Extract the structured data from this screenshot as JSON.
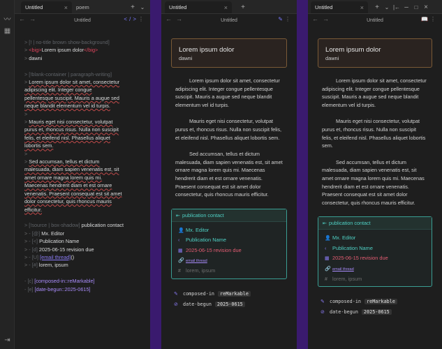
{
  "ribbon": {
    "icons": [
      "pulse-icon",
      "calendar-icon",
      "sidebar-toggle-icon"
    ]
  },
  "panes": {
    "left": {
      "tabs": [
        {
          "label": "Untitled",
          "active": true
        },
        {
          "label": "poem",
          "active": false
        }
      ],
      "title": "Untitled"
    },
    "mid": {
      "tabs": [
        {
          "label": "Untitled",
          "active": true
        }
      ],
      "title": "Untitled"
    },
    "right": {
      "tabs": [
        {
          "label": "Untitled",
          "active": true
        }
      ],
      "title": "Untitled"
    }
  },
  "editor": {
    "l1": "> [! | no-title brown show-background]",
    "l2_open": "<big>",
    "l2_text": "Lorem ipsum dolor",
    "l2_close": "</big>",
    "l3": "dawni",
    "l4": "> [!blank-container | paragraph-writing]",
    "p1": [
      "Lorem ipsum dolor sit amet, consectetur",
      "adipiscing elit. Integer congue",
      "pellentesque suscipit. Mauris a augue sed",
      "neque blandit elementum vel id turpis."
    ],
    "p2": [
      "Mauris eget nisi consectetur, volutpat",
      "purus et, rhoncus risus. Nulla non suscipit",
      "felis, et eleifend nisl. Phasellus aliquet",
      "lobortis sem."
    ],
    "p3": [
      "Sed accumsan, tellus et dictum",
      "malesuada, diam sapien venenatis est, sit",
      "amet ornare magna lorem quis mi.",
      "Maecenas hendrerit diam et est ornare",
      "venenatis. Praesent consequat est sit amet",
      "dolor consectetur, quis rhoncus mauris",
      "efficitur."
    ],
    "src_tag": "> [!source | box-shadow]",
    "src_title": "publication contact",
    "r1_tag": "- [@]",
    "r1_val": "Mx. Editor",
    "r2_tag": "- [<]",
    "r2_val": "Publication Name",
    "r3_tag": "- [d]",
    "r3_val": "2025-06-15 revision due",
    "r4_tag": "- [U]",
    "r4_link": "[email thread]",
    "r4_tail": "()",
    "r5_tag": "- [#]",
    "r5_val": "lorem, ipsum",
    "f1_tag": "- [c]",
    "f1_val": "[composed-in::reMarkable]",
    "f2_tag": "- [e]",
    "f2_val": "[date-begun::2025-0615]"
  },
  "preview": {
    "title": "Lorem ipsum dolor",
    "author": "dawni",
    "p1": "Lorem ipsum dolor sit amet, consectetur adipiscing elit. Integer congue pellentesque suscipit. Mauris a augue sed neque blandit elementum vel id turpis.",
    "p2": "Mauris eget nisi consectetur, volutpat purus et, rhoncus risus. Nulla non suscipit felis, et eleifend nisl. Phasellus aliquet lobortis sem.",
    "p3": "Sed accumsan, tellus et dictum malesuada, diam sapien venenatis est, sit amet ornare magna lorem quis mi. Maecenas hendrerit diam et est ornare venenatis. Praesent consequat est sit amet dolor consectetur, quis rhoncus mauris efficitur.",
    "pub_title": "publication contact",
    "pub_name": "Mx. Editor",
    "pub_pub": "Publication Name",
    "pub_date": "2025-06-15 revision due",
    "pub_link": "email thread",
    "pub_tags": "lorem, ipsum",
    "prop1_key": "composed-in",
    "prop1_val": "reMarkable",
    "prop2_key": "date-begun",
    "prop2_val": "2025-0615"
  },
  "colors": {
    "accent": "#8b7cf6",
    "teal": "#4fd1c5",
    "brown_border": "#7a5a36",
    "background": "#1e1e1e"
  }
}
